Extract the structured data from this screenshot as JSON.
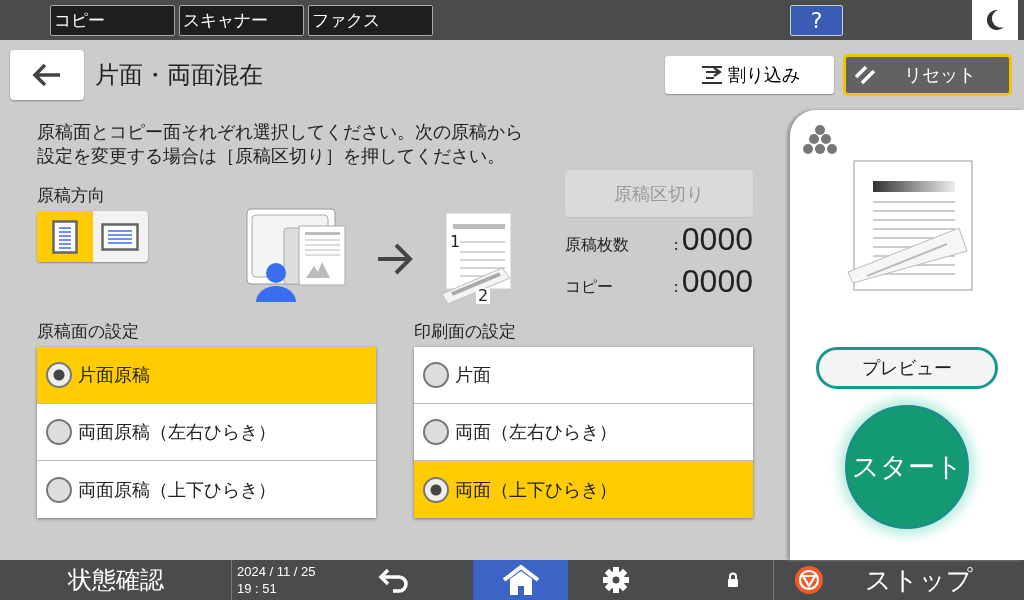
{
  "top_tabs": [
    {
      "label": "コピー"
    },
    {
      "label": "スキャナー"
    },
    {
      "label": "ファクス"
    }
  ],
  "help_button": {
    "label": "?"
  },
  "header": {
    "title": "片面・両面混在",
    "interrupt_button": "割り込み",
    "reset_button": "リセット"
  },
  "instruction": [
    "原稿面とコピー面それぞれ選択してください。次の原稿から",
    "設定を変更する場合は［原稿区切り］を押してください。"
  ],
  "orientation": {
    "label": "原稿方向",
    "options": [
      {
        "kind": "portrait",
        "selected": true
      },
      {
        "kind": "landscape",
        "selected": false
      }
    ]
  },
  "divider_button": {
    "label": "原稿区切り",
    "disabled": true
  },
  "counts": [
    {
      "label": "原稿枚数",
      "separator": ":",
      "value": "0000"
    },
    {
      "label": "コピー",
      "separator": ":",
      "value": "0000"
    }
  ],
  "result_page_numbers": [
    "1",
    "2"
  ],
  "original_side": {
    "label": "原稿面の設定",
    "options": [
      {
        "label": "片面原稿",
        "selected": true
      },
      {
        "label": "両面原稿（左右ひらき）",
        "selected": false
      },
      {
        "label": "両面原稿（上下ひらき）",
        "selected": false
      }
    ]
  },
  "print_side": {
    "label": "印刷面の設定",
    "options": [
      {
        "label": "片面",
        "selected": false
      },
      {
        "label": "両面（左右ひらき）",
        "selected": false
      },
      {
        "label": "両面（上下ひらき）",
        "selected": true
      }
    ]
  },
  "preview_button": "プレビュー",
  "start_button": "スタート",
  "bottom_bar": {
    "status": "状態確認",
    "date": "2024 / 11 / 25",
    "time": "19 : 51",
    "home_selected": true,
    "stop": "ストップ"
  }
}
